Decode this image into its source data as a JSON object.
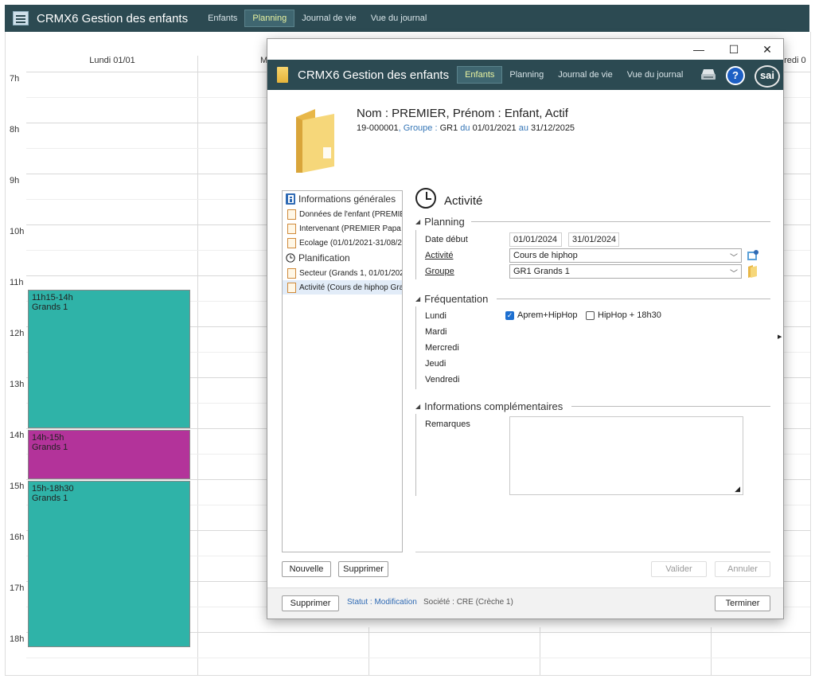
{
  "background": {
    "title": "CRMX6 Gestion des enfants",
    "nav": [
      "Enfants",
      "Planning",
      "Journal de vie",
      "Vue du journal"
    ],
    "active_nav": "Planning",
    "calendar": {
      "day_header": "Lundi 01/01",
      "partial_header_2": "M",
      "partial_header_right": "dredi 0",
      "hours": [
        "7h",
        "8h",
        "9h",
        "10h",
        "11h",
        "12h",
        "13h",
        "14h",
        "15h",
        "16h",
        "17h",
        "18h"
      ],
      "events": [
        {
          "time": "11h15-14h",
          "group": "Grands 1",
          "color": "#2fb3a8",
          "start_hour": 11.25,
          "end_hour": 14.0
        },
        {
          "time": "14h-15h",
          "group": "Grands 1",
          "color": "#b3339a",
          "start_hour": 14.0,
          "end_hour": 15.0
        },
        {
          "time": "15h-18h30",
          "group": "Grands 1",
          "color": "#2fb3a8",
          "start_hour": 15.0,
          "end_hour": 18.3
        }
      ]
    }
  },
  "dialog": {
    "window_controls": {
      "minimize": "—",
      "maximize": "☐",
      "close": "✕"
    },
    "title": "CRMX6 Gestion des enfants",
    "nav": [
      "Enfants",
      "Planning",
      "Journal de vie",
      "Vue du journal"
    ],
    "active_nav": "Enfants",
    "logo_text": "sai",
    "help_label": "?",
    "child": {
      "name_line": "Nom : PREMIER, Prénom : Enfant, Actif",
      "id": "19-000001",
      "groupe_label": ", Groupe : ",
      "groupe": "GR1",
      "du_label": " du ",
      "du": "01/01/2021",
      "au_label": " au ",
      "au": "31/12/2025"
    },
    "tree": {
      "section1": "Informations générales",
      "items1": [
        "Données de l'enfant (PREMIER",
        "Intervenant (PREMIER Papa Pé",
        "Ecolage (01/01/2021-31/08/20"
      ],
      "section2": "Planification",
      "items2": [
        "Secteur (Grands 1, 01/01/202",
        "Activité (Cours de hiphop Gra"
      ],
      "selected": "Activité (Cours de hiphop Gra"
    },
    "tree_buttons": {
      "new": "Nouvelle",
      "delete": "Supprimer"
    },
    "form": {
      "title": "Activité",
      "planning_group": "Planning",
      "date_debut_label": "Date début",
      "date_debut": "01/01/2024",
      "date_fin": "31/01/2024",
      "activite_label": "Activité",
      "activite_value": "Cours de hiphop",
      "groupe_label": "Groupe",
      "groupe_value": "GR1 Grands 1",
      "frequentation_group": "Fréquentation",
      "days": [
        "Lundi",
        "Mardi",
        "Mercredi",
        "Jeudi",
        "Vendredi"
      ],
      "options": [
        {
          "label": "Aprem+HipHop",
          "checked": true
        },
        {
          "label": "HipHop + 18h30",
          "checked": false
        }
      ],
      "infos_group": "Informations complémentaires",
      "remarques_label": "Remarques",
      "remarques_value": ""
    },
    "action_buttons": {
      "valider": "Valider",
      "annuler": "Annuler"
    },
    "footer": {
      "delete": "Supprimer",
      "statut": "Statut : Modification",
      "societe": "Société : CRE (Crèche 1)",
      "terminer": "Terminer"
    }
  }
}
